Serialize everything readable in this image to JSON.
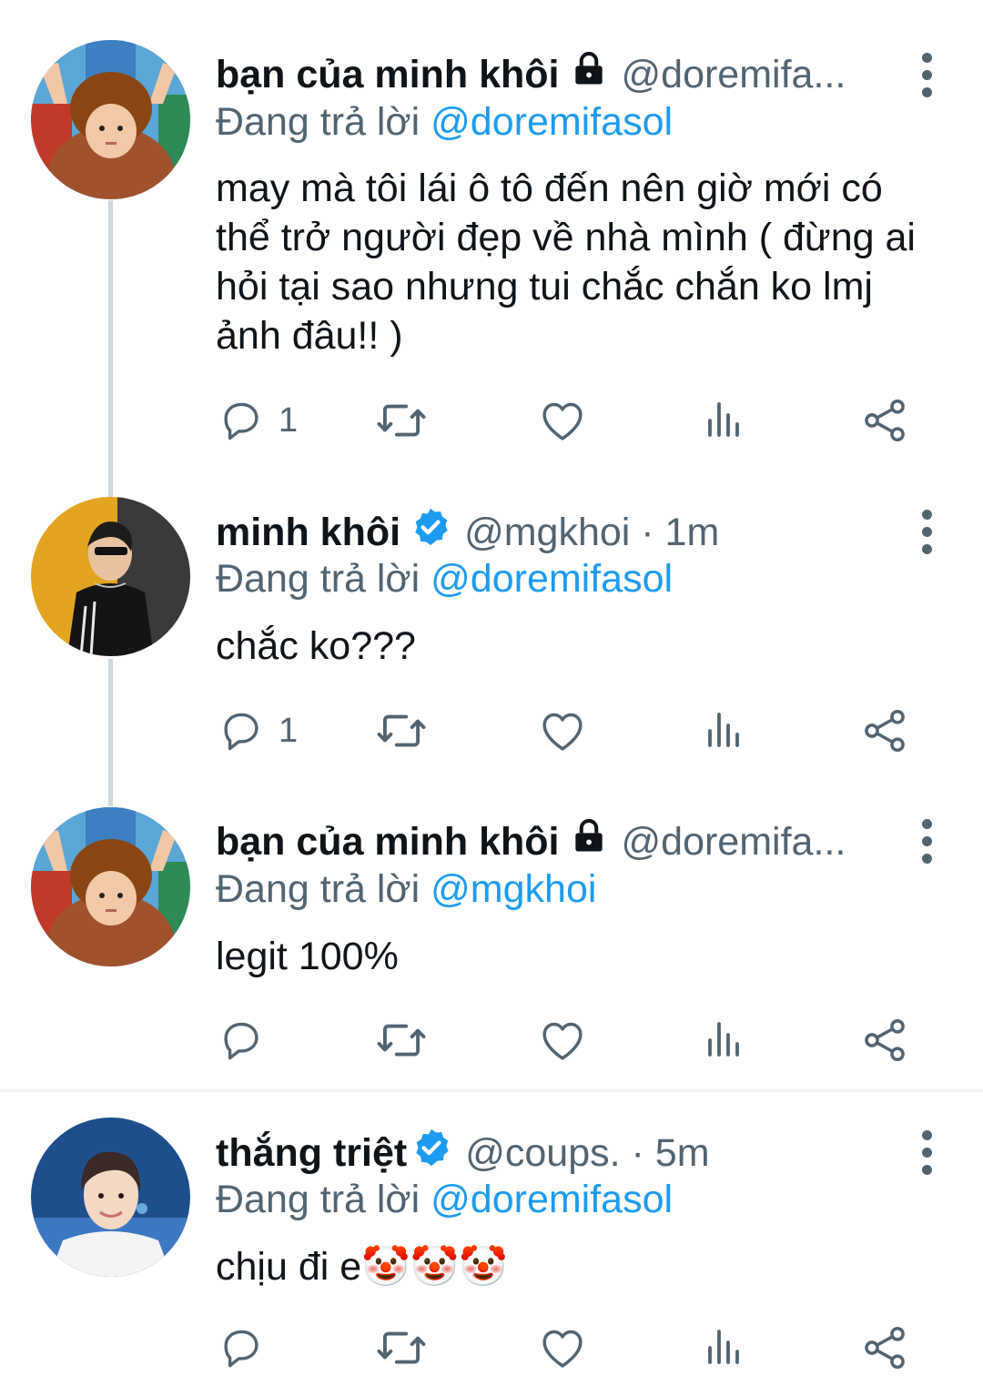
{
  "tweets": [
    {
      "name": "bạn của minh khôi",
      "handle": "@doremifa...",
      "replying_prefix": "Đang trả lời",
      "replying_to": "@doremifasol",
      "text": "may mà tôi lái ô tô đến nên giờ mới có thể trở người đẹp về nhà mình ( đừng ai hỏi tại sao nhưng tui chắc chắn ko lmj ảnh đâu!! )",
      "reply_count": "1"
    },
    {
      "name": "minh khôi",
      "handle": "@mgkhoi · 1m",
      "replying_prefix": "Đang trả lời",
      "replying_to": "@doremifasol",
      "text": "chắc ko???",
      "reply_count": "1"
    },
    {
      "name": "bạn của minh khôi",
      "handle": "@doremifa...",
      "replying_prefix": "Đang trả lời",
      "replying_to": "@mgkhoi",
      "text": "legit 100%",
      "reply_count": ""
    },
    {
      "name": "thắng triệt",
      "handle": "@coups. · 5m",
      "replying_prefix": "Đang trả lời",
      "replying_to": "@doremifasol",
      "text": "chịu đi e🤡🤡🤡",
      "reply_count": ""
    }
  ],
  "colors": {
    "accent": "#1d9bf0",
    "secondary_text": "#536471",
    "thread_line": "#cfd9de"
  },
  "icons": [
    "lock-icon",
    "verified-badge-icon",
    "more-icon",
    "reply-icon",
    "retweet-icon",
    "like-icon",
    "views-icon",
    "share-icon",
    "clown-emoji"
  ]
}
